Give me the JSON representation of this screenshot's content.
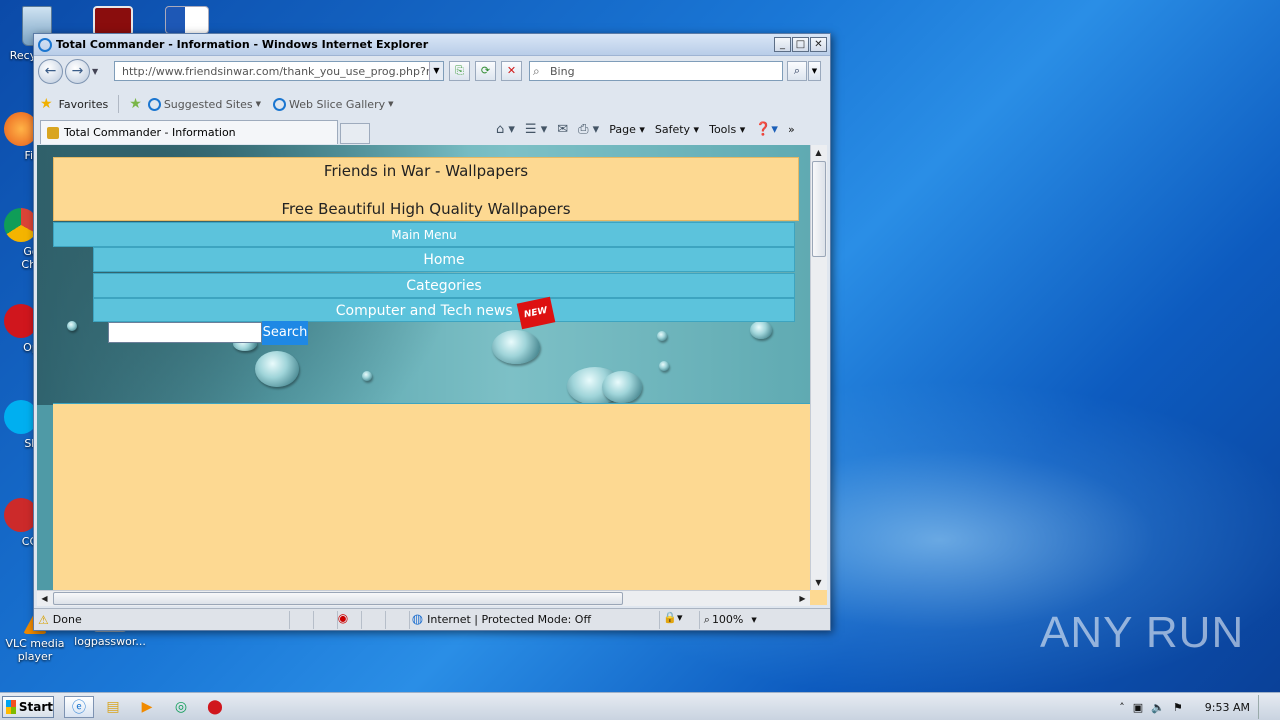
{
  "desktop": {
    "icons": [
      {
        "label": "Recy",
        "icon": "recycle-bin-icon"
      },
      {
        "label": "",
        "icon": "acrobat-icon"
      },
      {
        "label": "",
        "icon": "word-icon"
      },
      {
        "label": "Fir",
        "icon": "firefox-icon"
      },
      {
        "label": "Go\nChr",
        "icon": "chrome-icon"
      },
      {
        "label": "Op",
        "icon": "opera-icon"
      },
      {
        "label": "Sk",
        "icon": "skype-icon"
      },
      {
        "label": "CCl",
        "icon": "ccleaner-icon"
      },
      {
        "label": "VLC media player",
        "icon": "vlc-icon"
      },
      {
        "label": "logpasswor...",
        "icon": "file-icon"
      }
    ],
    "watermark": "ANY RUN"
  },
  "window": {
    "title": "Total Commander - Information - Windows Internet Explorer",
    "address": "http://www.friendsinwar.com/thank_you_use_prog.php?nar",
    "search_placeholder": "Bing",
    "favorites_label": "Favorites",
    "suggested_sites": "Suggested Sites",
    "web_slice_gallery": "Web Slice Gallery",
    "tab_title": "Total Commander - Information",
    "commands": {
      "page": "Page",
      "safety": "Safety",
      "tools": "Tools"
    },
    "status_text": "Done",
    "zone_text": "Internet | Protected Mode: Off",
    "zoom": "100%"
  },
  "page": {
    "header_title": "Friends in War - Wallpapers",
    "header_subtitle": "Free Beautiful High Quality Wallpapers",
    "menu_title": "Main Menu",
    "menu_items": [
      "Home",
      "Categories",
      "Computer and Tech news"
    ],
    "new_badge": "NEW",
    "search_button": "Search",
    "search_value": ""
  },
  "taskbar": {
    "start_label": "Start",
    "clock": "9:53 AM"
  }
}
